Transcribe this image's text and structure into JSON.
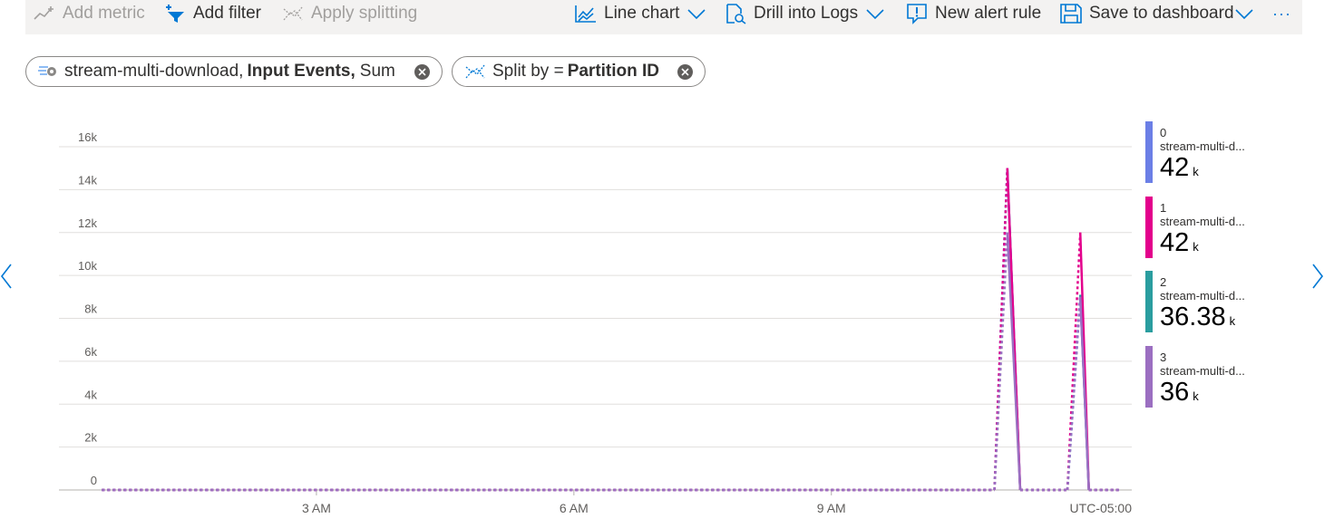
{
  "toolbar": {
    "add_metric": "Add metric",
    "add_filter": "Add filter",
    "apply_splitting": "Apply splitting",
    "line_chart": "Line chart",
    "drill_into_logs": "Drill into Logs",
    "new_alert_rule": "New alert rule",
    "save_to_dashboard": "Save to dashboard",
    "more": "···"
  },
  "pills": {
    "metric": {
      "resource": "stream-multi-download,",
      "metric": "Input Events,",
      "aggregation": "Sum"
    },
    "split": {
      "prefix": "Split by = ",
      "value": "Partition ID"
    }
  },
  "colors": {
    "accent": "#0078d4",
    "series0": "#6b7fe6",
    "series1": "#e3008c",
    "series2": "#2a9d9f",
    "series3": "#9b6fc1"
  },
  "legend": [
    {
      "name": "0",
      "resource": "stream-multi-d...",
      "value": "42",
      "unit": "k",
      "color": "#6b7fe6"
    },
    {
      "name": "1",
      "resource": "stream-multi-d...",
      "value": "42",
      "unit": "k",
      "color": "#e3008c"
    },
    {
      "name": "2",
      "resource": "stream-multi-d...",
      "value": "36.38",
      "unit": "k",
      "color": "#2a9d9f"
    },
    {
      "name": "3",
      "resource": "stream-multi-d...",
      "value": "36",
      "unit": "k",
      "color": "#9b6fc1"
    }
  ],
  "chart_data": {
    "type": "line",
    "xlabel": "",
    "ylabel": "",
    "timezone": "UTC-05:00",
    "x_ticks": [
      "3 AM",
      "6 AM",
      "9 AM"
    ],
    "x_tick_hours": [
      3,
      6,
      9
    ],
    "y_ticks": [
      "0",
      "2k",
      "4k",
      "6k",
      "8k",
      "10k",
      "12k",
      "14k",
      "16k"
    ],
    "ylim": [
      0,
      16000
    ],
    "xlim_hours": [
      0,
      12.5
    ],
    "grid": true,
    "legend_position": "right",
    "series": [
      {
        "name": "0",
        "color": "#6b7fe6",
        "points": [
          [
            0.5,
            0
          ],
          [
            10.9,
            0
          ],
          [
            11.05,
            15000
          ],
          [
            11.2,
            0
          ],
          [
            11.75,
            0
          ],
          [
            11.9,
            9000
          ],
          [
            12.0,
            0
          ],
          [
            12.35,
            0
          ]
        ]
      },
      {
        "name": "1",
        "color": "#e3008c",
        "points": [
          [
            0.5,
            0
          ],
          [
            10.9,
            0
          ],
          [
            11.05,
            15000
          ],
          [
            11.2,
            0
          ],
          [
            11.75,
            0
          ],
          [
            11.9,
            12000
          ],
          [
            12.0,
            0
          ],
          [
            12.35,
            0
          ]
        ]
      },
      {
        "name": "2",
        "color": "#2a9d9f",
        "points": [
          [
            0.5,
            0
          ],
          [
            10.9,
            0
          ],
          [
            11.05,
            15000
          ],
          [
            11.2,
            0
          ],
          [
            11.75,
            0
          ],
          [
            11.9,
            9100
          ],
          [
            12.0,
            0
          ],
          [
            12.35,
            0
          ]
        ]
      },
      {
        "name": "3",
        "color": "#9b6fc1",
        "points": [
          [
            0.5,
            0
          ],
          [
            10.9,
            0
          ],
          [
            11.05,
            12000
          ],
          [
            11.2,
            0
          ],
          [
            11.75,
            0
          ],
          [
            11.9,
            9000
          ],
          [
            12.0,
            0
          ],
          [
            12.35,
            0
          ]
        ]
      }
    ]
  }
}
